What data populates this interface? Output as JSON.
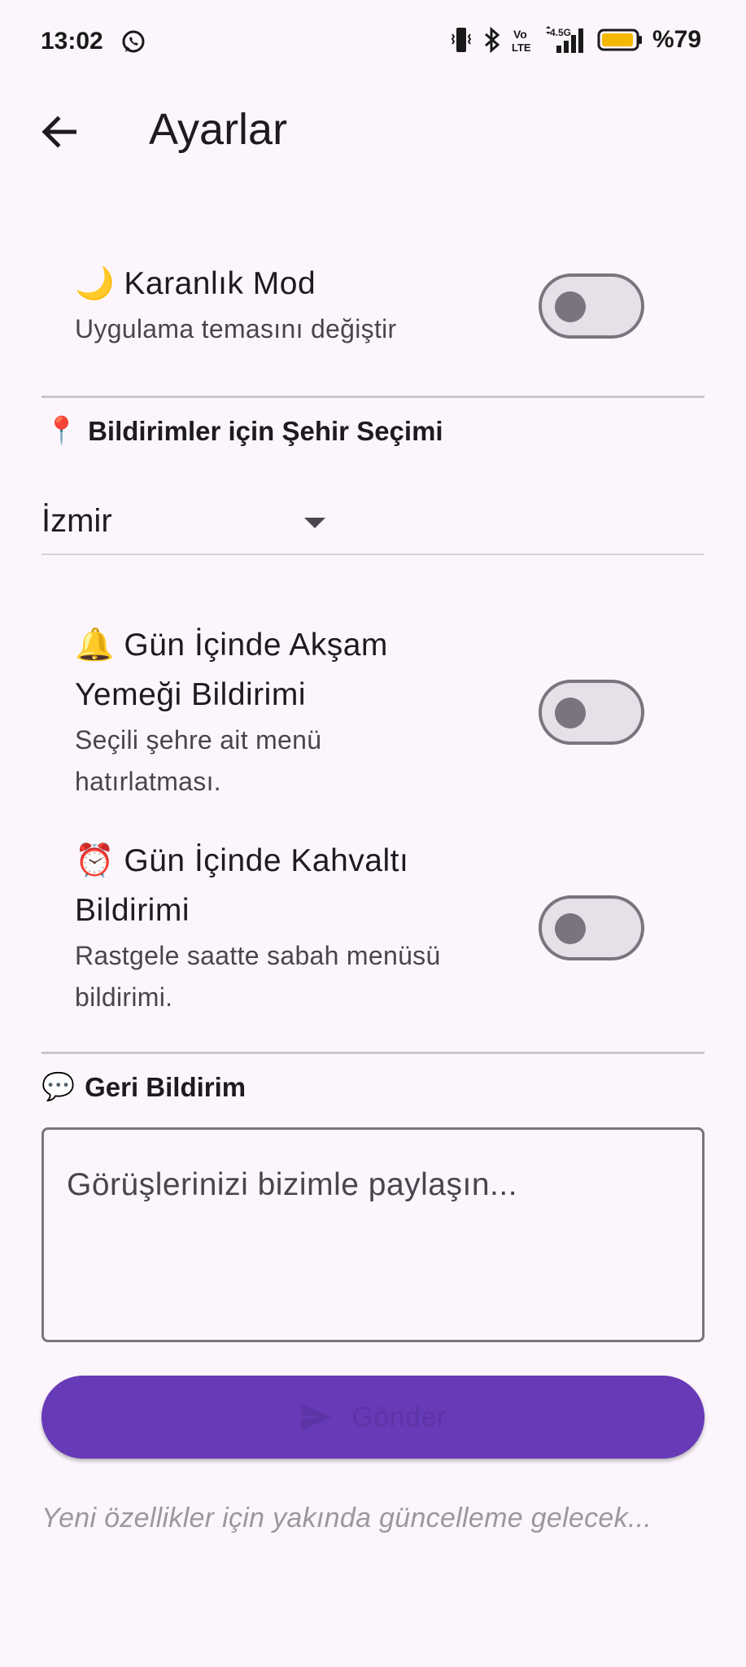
{
  "status_bar": {
    "time": "13:02",
    "battery_percent": "%79",
    "icons": [
      "whatsapp-icon",
      "vibrate-icon",
      "bluetooth-icon",
      "volte-icon",
      "signal-4.5g-icon",
      "battery-icon"
    ]
  },
  "app_bar": {
    "back_icon": "arrow-left-icon",
    "title": "Ayarlar"
  },
  "dark_mode": {
    "emoji": "🌙",
    "title": "Karanlık Mod",
    "subtitle": "Uygulama temasını değiştir",
    "enabled": false
  },
  "city_section": {
    "emoji": "📍",
    "heading": "Bildirimler için Şehir Seçimi",
    "selected_city": "İzmir"
  },
  "dinner_notification": {
    "emoji": "🔔",
    "title_line1": "Gün İçinde Akşam",
    "title_line2": "Yemeği Bildirimi",
    "subtitle_line1": "Seçili şehre ait menü",
    "subtitle_line2": "hatırlatması.",
    "enabled": false
  },
  "breakfast_notification": {
    "emoji": "⏰",
    "title_line1": "Gün İçinde Kahvaltı",
    "title_line2": "Bildirimi",
    "subtitle_line1": "Rastgele saatte sabah menüsü",
    "subtitle_line2": "bildirimi.",
    "enabled": false
  },
  "feedback": {
    "emoji": "💬",
    "heading": "Geri Bildirim",
    "placeholder": "Görüşlerinizi bizimle paylaşın...",
    "value": "",
    "send_label": "Gönder",
    "send_icon": "send-icon"
  },
  "footer_note": "Yeni özellikler için yakında güncelleme gelecek...",
  "colors": {
    "background": "#fcf6fc",
    "primary_button": "#673ab7",
    "switch_off_track": "#e6e0e9",
    "switch_off_outline": "#79747e"
  }
}
